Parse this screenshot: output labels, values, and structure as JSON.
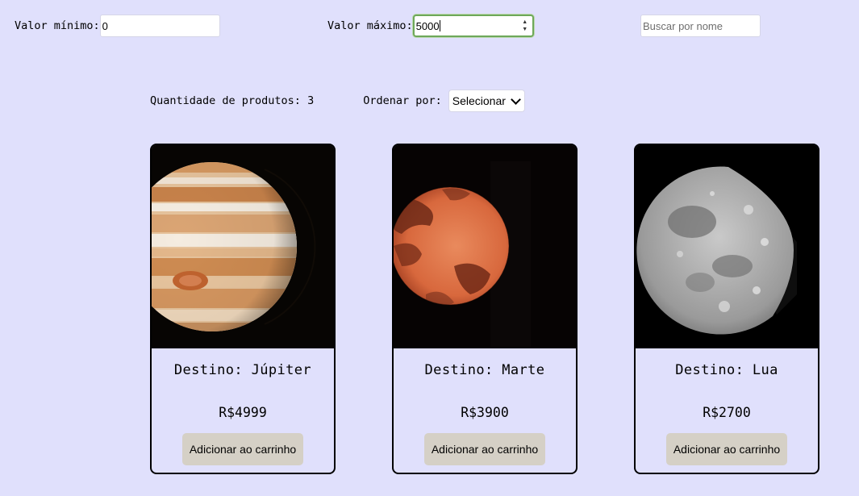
{
  "filters": {
    "min_label": "Valor mínimo:",
    "min_value": "0",
    "max_label": "Valor máximo:",
    "max_value": "5000",
    "search_placeholder": "Buscar por nome"
  },
  "toolbar": {
    "count_label": "Quantidade de produtos: 3",
    "sort_label": "Ordenar por:",
    "sort_selected": "Selecionar"
  },
  "products": [
    {
      "title": "Destino: Júpiter",
      "price": "R$4999",
      "button_label": "Adicionar ao carrinho",
      "image": "jupiter-photo"
    },
    {
      "title": "Destino: Marte",
      "price": "R$3900",
      "button_label": "Adicionar ao carrinho",
      "image": "mars-photo"
    },
    {
      "title": "Destino: Lua",
      "price": "R$2700",
      "button_label": "Adicionar ao carrinho",
      "image": "moon-photo"
    }
  ],
  "colors": {
    "page_background": "#e0e0fc",
    "button_background": "#d5d0c6",
    "focus_border": "#6ea85a"
  }
}
